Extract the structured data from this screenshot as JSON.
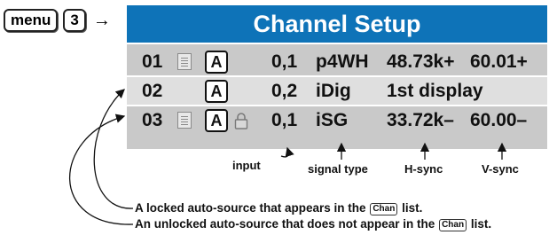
{
  "nav": {
    "menu_key": "menu",
    "number_key": "3"
  },
  "screen": {
    "title": "Channel Setup",
    "rows": [
      {
        "num": "01",
        "has_note": true,
        "auto": "A",
        "locked": false,
        "input": "0,1",
        "signal_type": "p4WH",
        "hsync": "48.73k+",
        "vsync": "60.01+"
      },
      {
        "num": "02",
        "has_note": false,
        "auto": "A",
        "locked": false,
        "input": "0,2",
        "signal_type": "iDig",
        "hsync": "1st display",
        "vsync": ""
      },
      {
        "num": "03",
        "has_note": true,
        "auto": "A",
        "locked": true,
        "input": "0,1",
        "signal_type": "iSG",
        "hsync": "33.72k–",
        "vsync": "60.00–"
      }
    ]
  },
  "labels": {
    "input": "input",
    "signal_type": "signal type",
    "hsync": "H-sync",
    "vsync": "V-sync"
  },
  "notes": {
    "locked_prefix": "A locked auto-source that appears in the",
    "locked_suffix": "list.",
    "unlocked_prefix": "An unlocked auto-source that does not appear in the",
    "unlocked_suffix": "list.",
    "chan_key": "Chan"
  },
  "colors": {
    "title_bar": "#0e73b8",
    "panel": "#c9c9c9",
    "highlight_row": "#dfdfdf"
  }
}
